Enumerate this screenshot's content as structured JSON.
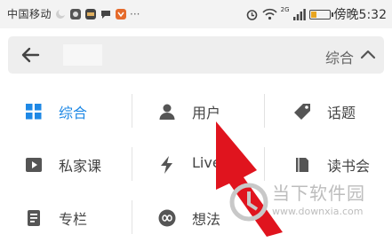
{
  "status_bar": {
    "carrier": "中国移动",
    "more_indicator": "···",
    "network_badge": "2G",
    "time": "傍晚5:32",
    "battery_level": 0.3
  },
  "search_bar": {
    "filter_label": "综合"
  },
  "categories": [
    {
      "label": "综合",
      "icon": "grid-icon",
      "active": true
    },
    {
      "label": "用户",
      "icon": "user-icon",
      "active": false
    },
    {
      "label": "话题",
      "icon": "tag-icon",
      "active": false
    },
    {
      "label": "私家课",
      "icon": "video-icon",
      "active": false
    },
    {
      "label": "Live",
      "icon": "lightning-icon",
      "active": false
    },
    {
      "label": "读书会",
      "icon": "book-icon",
      "active": false
    },
    {
      "label": "专栏",
      "icon": "column-icon",
      "active": false
    },
    {
      "label": "想法",
      "icon": "infinity-icon",
      "active": false
    }
  ],
  "watermark": {
    "title": "当下软件园",
    "url": "www.downxia.com"
  },
  "colors": {
    "accent": "#1e88e5",
    "icon_gray": "#555555",
    "arrow_red": "#e0141e"
  }
}
